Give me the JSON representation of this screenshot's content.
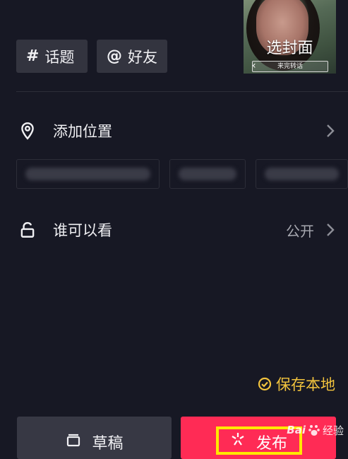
{
  "chips": {
    "topic": {
      "symbol": "#",
      "label": "话题"
    },
    "friend": {
      "symbol": "@",
      "label": "好友"
    }
  },
  "cover": {
    "caption": "选封面",
    "strip_text": "来完转话"
  },
  "location": {
    "label": "添加位置",
    "suggestions": [
      "",
      "",
      ""
    ]
  },
  "visibility": {
    "label": "谁可以看",
    "value": "公开"
  },
  "save_local": {
    "label": "保存本地",
    "checked": true
  },
  "actions": {
    "draft_label": "草稿",
    "publish_label": "发布"
  },
  "watermark": {
    "brand": "Bai",
    "suffix": "经验"
  },
  "colors": {
    "background": "#171824",
    "publish": "#ff2b55",
    "accent_save": "#f2c33d",
    "highlight": "#ffe800"
  }
}
